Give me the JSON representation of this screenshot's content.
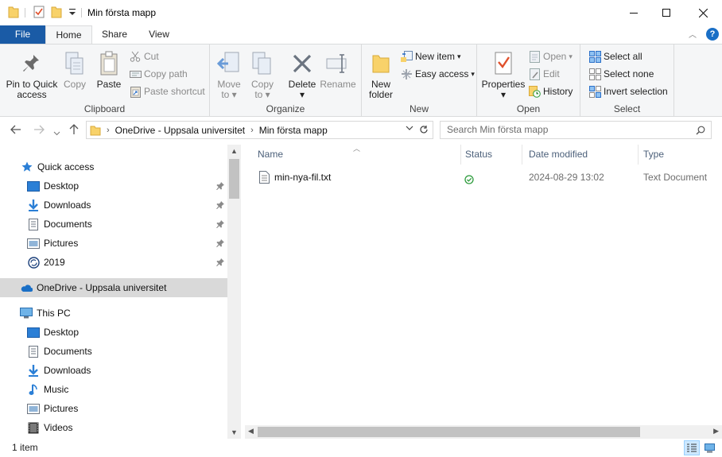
{
  "window": {
    "title": "Min första mapp",
    "controls": {
      "minimize": "—",
      "maximize": "☐",
      "close": "✕"
    }
  },
  "tabs": [
    {
      "label": "File"
    },
    {
      "label": "Home"
    },
    {
      "label": "Share"
    },
    {
      "label": "View"
    }
  ],
  "ribbon": {
    "clipboard": {
      "label": "Clipboard",
      "pin_line1": "Pin to Quick",
      "pin_line2": "access",
      "copy": "Copy",
      "paste": "Paste",
      "cut": "Cut",
      "copy_path": "Copy path",
      "paste_shortcut": "Paste shortcut"
    },
    "organize": {
      "label": "Organize",
      "move_to": "Move",
      "move_to_2": "to",
      "copy_to": "Copy",
      "copy_to_2": "to",
      "delete": "Delete",
      "rename": "Rename"
    },
    "new": {
      "label": "New",
      "new_folder_1": "New",
      "new_folder_2": "folder",
      "new_item": "New item",
      "easy_access": "Easy access"
    },
    "open": {
      "label": "Open",
      "properties": "Properties",
      "open": "Open",
      "edit": "Edit",
      "history": "History"
    },
    "select": {
      "label": "Select",
      "select_all": "Select all",
      "select_none": "Select none",
      "invert_selection": "Invert selection"
    }
  },
  "address": {
    "crumbs": [
      "OneDrive - Uppsala universitet",
      "Min första mapp"
    ],
    "search_placeholder": "Search Min första mapp"
  },
  "nav": {
    "quick_access": "Quick access",
    "quick_items": [
      "Desktop",
      "Downloads",
      "Documents",
      "Pictures",
      "2019"
    ],
    "onedrive": "OneDrive - Uppsala universitet",
    "this_pc": "This PC",
    "pc_items": [
      "Desktop",
      "Documents",
      "Downloads",
      "Music",
      "Pictures",
      "Videos"
    ]
  },
  "columns": {
    "name": "Name",
    "status": "Status",
    "date": "Date modified",
    "type": "Type"
  },
  "files": [
    {
      "name": "min-nya-fil.txt",
      "status": "synced",
      "date": "2024-08-29 13:02",
      "type": "Text Document"
    }
  ],
  "status": {
    "count": "1 item"
  },
  "colors": {
    "file_tab": "#1a5ba6",
    "accent": "#1a6fc6",
    "folder": "#f8d26a",
    "synced": "#2d9b3c"
  }
}
